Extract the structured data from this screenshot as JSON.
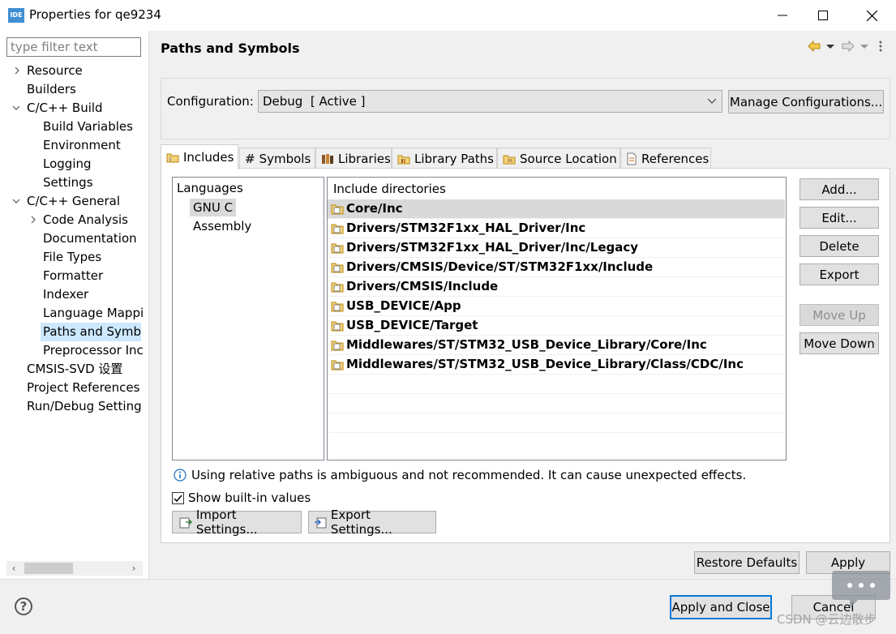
{
  "window": {
    "app_icon_text": "IDE",
    "title": "Properties for qe9234"
  },
  "left": {
    "filter_placeholder": "type filter text",
    "tree": [
      {
        "label": "Resource",
        "expandable": true,
        "expanded": false,
        "level": 0
      },
      {
        "label": "Builders",
        "expandable": false,
        "level": 0
      },
      {
        "label": "C/C++ Build",
        "expandable": true,
        "expanded": true,
        "level": 0
      },
      {
        "label": "Build Variables",
        "level": 1
      },
      {
        "label": "Environment",
        "level": 1
      },
      {
        "label": "Logging",
        "level": 1
      },
      {
        "label": "Settings",
        "level": 1
      },
      {
        "label": "C/C++ General",
        "expandable": true,
        "expanded": true,
        "level": 0
      },
      {
        "label": "Code Analysis",
        "expandable": true,
        "expanded": false,
        "level": 1
      },
      {
        "label": "Documentation",
        "level": 1
      },
      {
        "label": "File Types",
        "level": 1
      },
      {
        "label": "Formatter",
        "level": 1
      },
      {
        "label": "Indexer",
        "level": 1
      },
      {
        "label": "Language Mappi",
        "level": 1
      },
      {
        "label": "Paths and Symbo",
        "level": 1,
        "selected": true
      },
      {
        "label": "Preprocessor Inc",
        "level": 1
      },
      {
        "label": "CMSIS-SVD 设置",
        "level": 0
      },
      {
        "label": "Project References",
        "level": 0
      },
      {
        "label": "Run/Debug Setting",
        "level": 0
      }
    ]
  },
  "main": {
    "page_title": "Paths and Symbols",
    "configuration": {
      "label": "Configuration:",
      "value": "Debug  [ Active ]",
      "manage_button": "Manage Configurations..."
    },
    "tabs": [
      {
        "label": "Includes",
        "active": true
      },
      {
        "label": "Symbols"
      },
      {
        "label": "Libraries"
      },
      {
        "label": "Library Paths"
      },
      {
        "label": "Source Location"
      },
      {
        "label": "References"
      }
    ],
    "languages": {
      "header": "Languages",
      "items": [
        {
          "label": "GNU C",
          "selected": true
        },
        {
          "label": "Assembly"
        }
      ]
    },
    "includes": {
      "header": "Include directories",
      "rows": [
        {
          "path": "Core/Inc",
          "selected": true
        },
        {
          "path": "Drivers/STM32F1xx_HAL_Driver/Inc"
        },
        {
          "path": "Drivers/STM32F1xx_HAL_Driver/Inc/Legacy"
        },
        {
          "path": "Drivers/CMSIS/Device/ST/STM32F1xx/Include"
        },
        {
          "path": "Drivers/CMSIS/Include"
        },
        {
          "path": "USB_DEVICE/App"
        },
        {
          "path": "USB_DEVICE/Target"
        },
        {
          "path": "Middlewares/ST/STM32_USB_Device_Library/Core/Inc"
        },
        {
          "path": "Middlewares/ST/STM32_USB_Device_Library/Class/CDC/Inc"
        }
      ]
    },
    "side_buttons": {
      "add": "Add...",
      "edit": "Edit...",
      "delete": "Delete",
      "export": "Export",
      "move_up": "Move Up",
      "move_down": "Move Down"
    },
    "info_text": "Using relative paths is ambiguous and not recommended. It can cause unexpected effects.",
    "show_builtin": {
      "label": "Show built-in values",
      "checked": true
    },
    "import_settings": "Import Settings...",
    "export_settings": "Export Settings...",
    "restore_defaults": "Restore Defaults",
    "apply": "Apply"
  },
  "footer": {
    "apply_close": "Apply and Close",
    "cancel": "Cancel",
    "watermark": "CSDN @云边散步"
  },
  "colors": {
    "selection": "#cce8ff",
    "accent": "#0078d7",
    "folder_gold": "#d9a520"
  }
}
